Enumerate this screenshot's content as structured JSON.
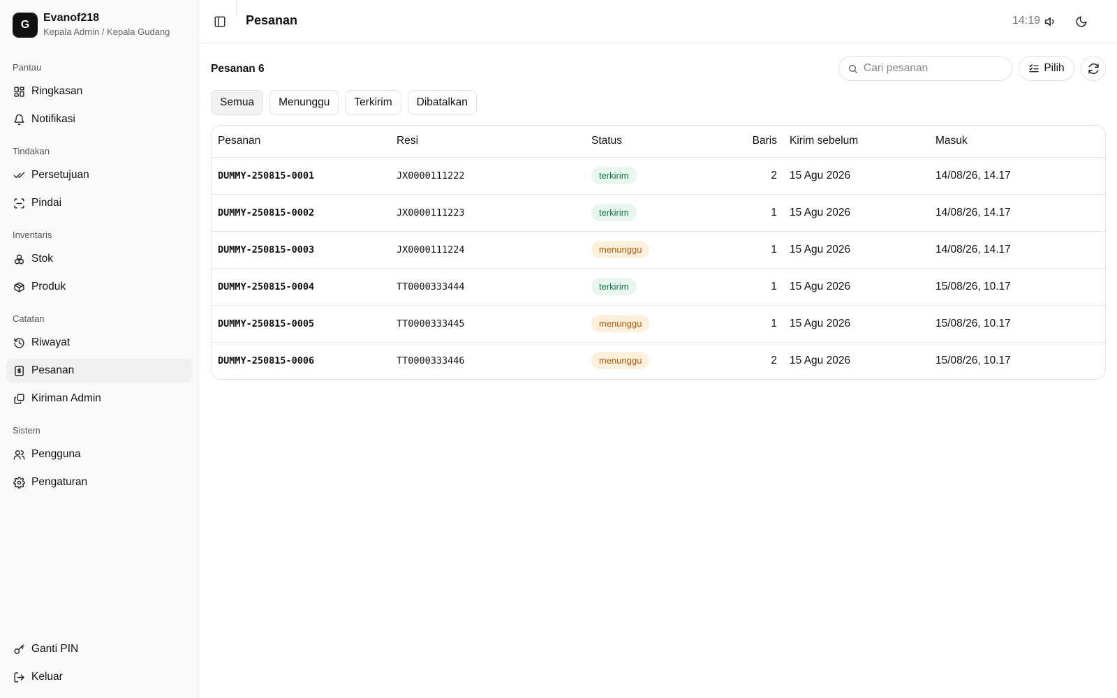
{
  "user": {
    "initial": "G",
    "name": "Evanof218",
    "role": "Kepala Admin / Kepala Gudang"
  },
  "nav": {
    "groups": [
      {
        "label": "Pantau",
        "items": [
          {
            "label": "Ringkasan",
            "icon": "dashboard-icon"
          },
          {
            "label": "Notifikasi",
            "icon": "bell-icon"
          }
        ]
      },
      {
        "label": "Tindakan",
        "items": [
          {
            "label": "Persetujuan",
            "icon": "double-check-icon"
          },
          {
            "label": "Pindai",
            "icon": "scan-icon"
          }
        ]
      },
      {
        "label": "Inventaris",
        "items": [
          {
            "label": "Stok",
            "icon": "boxes-icon"
          },
          {
            "label": "Produk",
            "icon": "package-icon"
          }
        ]
      },
      {
        "label": "Catatan",
        "items": [
          {
            "label": "Riwayat",
            "icon": "history-icon"
          },
          {
            "label": "Pesanan",
            "icon": "receipt-icon",
            "active": true
          },
          {
            "label": "Kiriman Admin",
            "icon": "copy-icon"
          }
        ]
      },
      {
        "label": "Sistem",
        "items": [
          {
            "label": "Pengguna",
            "icon": "users-icon"
          },
          {
            "label": "Pengaturan",
            "icon": "gear-icon"
          }
        ]
      }
    ],
    "bottom": [
      {
        "label": "Ganti PIN",
        "icon": "key-icon"
      },
      {
        "label": "Keluar",
        "icon": "logout-icon"
      }
    ]
  },
  "topbar": {
    "title": "Pesanan",
    "time": "14:19"
  },
  "main": {
    "count_title": "Pesanan 6",
    "search_placeholder": "Cari pesanan",
    "pilih_label": "Pilih",
    "tabs": [
      {
        "label": "Semua",
        "active": true
      },
      {
        "label": "Menunggu"
      },
      {
        "label": "Terkirim"
      },
      {
        "label": "Dibatalkan"
      }
    ],
    "columns": {
      "order": "Pesanan",
      "resi": "Resi",
      "status": "Status",
      "rows": "Baris",
      "ship_before": "Kirim sebelum",
      "received": "Masuk"
    },
    "rows": [
      {
        "order": "DUMMY-250815-0001",
        "resi": "JX0000111222",
        "status": "terkirim",
        "rows": "2",
        "ship_before": "15 Agu 2026",
        "received": "14/08/26, 14.17"
      },
      {
        "order": "DUMMY-250815-0002",
        "resi": "JX0000111223",
        "status": "terkirim",
        "rows": "1",
        "ship_before": "15 Agu 2026",
        "received": "14/08/26, 14.17"
      },
      {
        "order": "DUMMY-250815-0003",
        "resi": "JX0000111224",
        "status": "menunggu",
        "rows": "1",
        "ship_before": "15 Agu 2026",
        "received": "14/08/26, 14.17"
      },
      {
        "order": "DUMMY-250815-0004",
        "resi": "TT0000333444",
        "status": "terkirim",
        "rows": "1",
        "ship_before": "15 Agu 2026",
        "received": "15/08/26, 10.17"
      },
      {
        "order": "DUMMY-250815-0005",
        "resi": "TT0000333445",
        "status": "menunggu",
        "rows": "1",
        "ship_before": "15 Agu 2026",
        "received": "15/08/26, 10.17"
      },
      {
        "order": "DUMMY-250815-0006",
        "resi": "TT0000333446",
        "status": "menunggu",
        "rows": "2",
        "ship_before": "15 Agu 2026",
        "received": "15/08/26, 10.17"
      }
    ]
  },
  "colors": {
    "terkirim_bg": "#e8f6ef",
    "terkirim_text": "#157a4a",
    "menunggu_bg": "#fdf0dc",
    "menunggu_text": "#b5580c",
    "active_nav": "#f0f0f0"
  }
}
